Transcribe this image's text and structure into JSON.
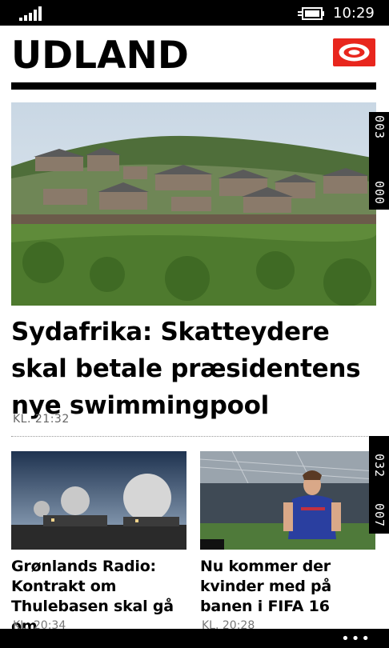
{
  "status": {
    "time": "10:29"
  },
  "header": {
    "title": "UDLAND",
    "logo": "eye-logo"
  },
  "hero": {
    "title": "Sydafrika: Skatteydere skal betale præsidentens nye swimmingpool",
    "time": "KL. 21:32",
    "image": "hillside-compound-photo"
  },
  "cards": [
    {
      "title": "Grønlands Radio: Kontrakt om Thulebasen skal gå om",
      "time": "KL. 20:34",
      "image": "radar-domes-photo"
    },
    {
      "title": "Nu kommer der kvinder med på banen i FIFA 16",
      "time": "KL. 20:28",
      "image": "soccer-player-photo"
    }
  ],
  "page_tabs": [
    {
      "top": "003",
      "bottom": "000"
    },
    {
      "top": "032",
      "bottom": "007"
    }
  ],
  "appbar": {
    "more_label": "•••"
  },
  "colors": {
    "brand": "#e8261d",
    "chrome": "#000000"
  }
}
